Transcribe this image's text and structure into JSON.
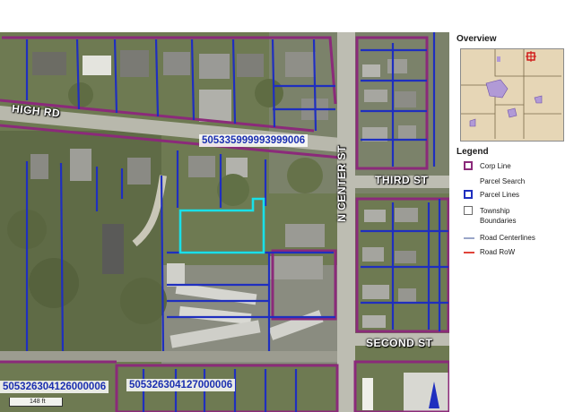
{
  "map": {
    "roads": [
      {
        "id": "high-rd",
        "label": "HIGH RD"
      },
      {
        "id": "n-center-st",
        "label": "N CENTER ST"
      },
      {
        "id": "third-st",
        "label": "THIRD ST"
      },
      {
        "id": "second-st",
        "label": "SECOND ST"
      }
    ],
    "parcel_ids": [
      "505335999993999006",
      "505326304126000006",
      "505326304127000006"
    ],
    "scale_label": "148 ft",
    "colors": {
      "parcel_line": "#1f2fbf",
      "corp_line": "#8b2a7a",
      "selected_parcel": "#19e0e8",
      "road": "#bdbdb2"
    }
  },
  "sidebar": {
    "overview_title": "Overview",
    "legend_title": "Legend",
    "legend_items": [
      {
        "label": "Corp Line",
        "kind": "box",
        "color": "#8b2a7a"
      },
      {
        "label": "Parcel Search",
        "kind": "none",
        "color": ""
      },
      {
        "label": "Parcel Lines",
        "kind": "box",
        "color": "#1f2fbf"
      },
      {
        "label": "Township",
        "kind": "box",
        "color": "#6b6b6b"
      },
      {
        "label": "Boundaries",
        "kind": "none",
        "color": ""
      },
      {
        "label": "Road Centerlines",
        "kind": "line",
        "color": "#9aa6c8"
      },
      {
        "label": "Road RoW",
        "kind": "line",
        "color": "#e0443a"
      }
    ]
  }
}
